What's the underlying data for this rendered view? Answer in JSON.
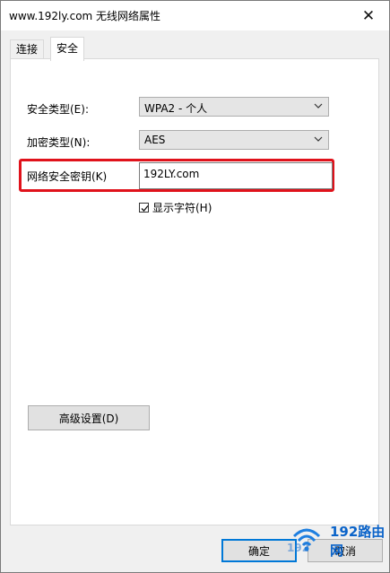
{
  "window": {
    "title": "www.192ly.com 无线网络属性",
    "close_glyph": "✕"
  },
  "tabs": [
    {
      "label": "连接",
      "active": false
    },
    {
      "label": "安全",
      "active": true
    }
  ],
  "security": {
    "type_label": "安全类型(E):",
    "type_value": "WPA2 - 个人",
    "encryption_label": "加密类型(N):",
    "encryption_value": "AES",
    "key_label": "网络安全密钥(K)",
    "key_value": "192LY.com",
    "show_chars_label": "显示字符(H)",
    "show_chars_checked": true,
    "advanced_button": "高级设置(D)"
  },
  "footer": {
    "ok_label": "确定",
    "cancel_label": "取消"
  },
  "watermark": {
    "brand": "192路由网",
    "sub": "192"
  },
  "colors": {
    "highlight": "#e0121b",
    "accent": "#0078d7"
  }
}
